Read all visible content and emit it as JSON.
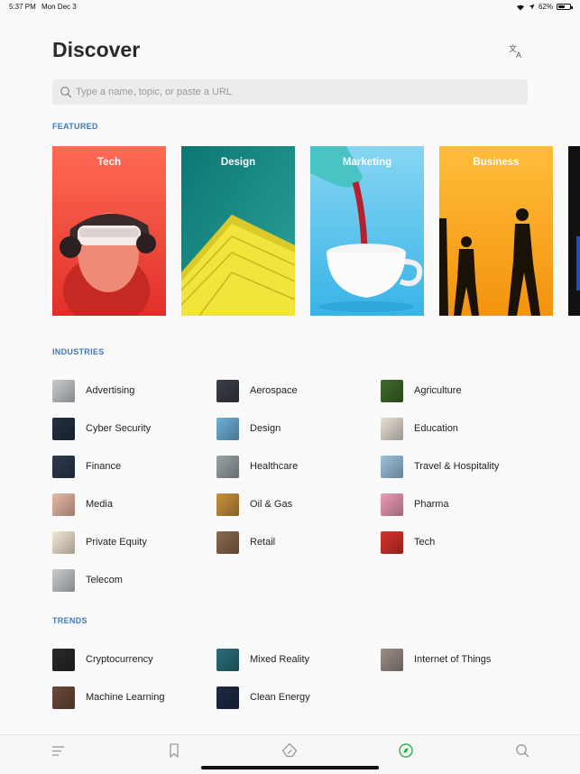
{
  "status_bar": {
    "time": "5:37 PM",
    "date": "Mon Dec 3",
    "battery": "62%",
    "battery_level": 0.62
  },
  "page": {
    "title": "Discover"
  },
  "search": {
    "placeholder": "Type a name, topic, or paste a URL"
  },
  "featured": {
    "label": "FEATURED",
    "cards": [
      {
        "label": "Tech",
        "colors": [
          "#ff6a52",
          "#e8372f"
        ]
      },
      {
        "label": "Design",
        "colors": [
          "#0f7e78",
          "#2a9f96"
        ]
      },
      {
        "label": "Marketing",
        "colors": [
          "#7dd3f2",
          "#3db6e8"
        ]
      },
      {
        "label": "Business",
        "colors": [
          "#ffb338",
          "#f39a12"
        ]
      }
    ]
  },
  "industries": {
    "label": "INDUSTRIES",
    "items": [
      {
        "label": "Advertising",
        "icon": "advertising-thumb",
        "color": "#c9cdd0"
      },
      {
        "label": "Aerospace",
        "icon": "aerospace-thumb",
        "color": "#3a3f47"
      },
      {
        "label": "Agriculture",
        "icon": "agriculture-thumb",
        "color": "#3e6b2a"
      },
      {
        "label": "Cyber Security",
        "icon": "cyber-security-thumb",
        "color": "#243041"
      },
      {
        "label": "Design",
        "icon": "design-thumb",
        "color": "#6fb0d8"
      },
      {
        "label": "Education",
        "icon": "education-thumb",
        "color": "#e8e1d6"
      },
      {
        "label": "Finance",
        "icon": "finance-thumb",
        "color": "#2d3a4f"
      },
      {
        "label": "Healthcare",
        "icon": "healthcare-thumb",
        "color": "#9aa2a6"
      },
      {
        "label": "Travel & Hospitality",
        "icon": "travel-thumb",
        "color": "#9bc3dd"
      },
      {
        "label": "Media",
        "icon": "media-thumb",
        "color": "#e9b9a6"
      },
      {
        "label": "Oil & Gas",
        "icon": "oil-gas-thumb",
        "color": "#c9923d"
      },
      {
        "label": "Pharma",
        "icon": "pharma-thumb",
        "color": "#ec9cb8"
      },
      {
        "label": "Private Equity",
        "icon": "private-equity-thumb",
        "color": "#f4e9d8"
      },
      {
        "label": "Retail",
        "icon": "retail-thumb",
        "color": "#8a6a4e"
      },
      {
        "label": "Tech",
        "icon": "tech-thumb",
        "color": "#d9322b"
      },
      {
        "label": "Telecom",
        "icon": "telecom-thumb",
        "color": "#c9ccd0"
      }
    ]
  },
  "trends": {
    "label": "TRENDS",
    "items": [
      {
        "label": "Cryptocurrency",
        "icon": "cryptocurrency-thumb",
        "color": "#2a2a2a"
      },
      {
        "label": "Mixed Reality",
        "icon": "mixed-reality-thumb",
        "color": "#2a6f7a"
      },
      {
        "label": "Internet of Things",
        "icon": "internet-of-things-thumb",
        "color": "#9b8f86"
      },
      {
        "label": "Machine Learning",
        "icon": "machine-learning-thumb",
        "color": "#6b4a3a"
      },
      {
        "label": "Clean Energy",
        "icon": "clean-energy-thumb",
        "color": "#1d2a44"
      }
    ]
  },
  "tab_bar": {
    "tabs": [
      {
        "icon": "menu-icon",
        "active": false
      },
      {
        "icon": "bookmark-icon",
        "active": false
      },
      {
        "icon": "feedly-icon",
        "active": false
      },
      {
        "icon": "compass-icon",
        "active": true
      },
      {
        "icon": "search-icon",
        "active": false
      }
    ],
    "active_color": "#2bb24c",
    "inactive_color": "#9a9a9a"
  }
}
